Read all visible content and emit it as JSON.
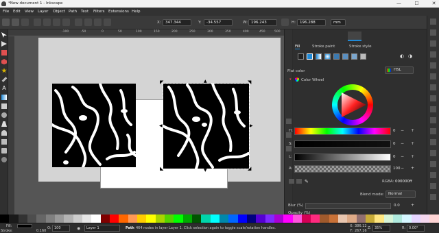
{
  "window": {
    "title": "*New document 1 - Inkscape",
    "minimize": "—",
    "maximize": "☐",
    "close": "✕"
  },
  "menu": [
    "File",
    "Edit",
    "View",
    "Layer",
    "Object",
    "Path",
    "Text",
    "Filters",
    "Extensions",
    "Help"
  ],
  "toolcontrols": {
    "x_label": "X:",
    "x_value": "347.344",
    "y_label": "Y:",
    "y_value": "-34.557",
    "w_label": "W:",
    "w_value": "196.243",
    "h_label": "H:",
    "h_value": "196.288",
    "unit": "mm"
  },
  "ruler_ticks": [
    "-100",
    "-50",
    "0",
    "50",
    "100",
    "150",
    "200",
    "250",
    "300",
    "350",
    "400",
    "450",
    "500"
  ],
  "fill_stroke": {
    "tabs": [
      "Fill",
      "Stroke paint",
      "Stroke style"
    ],
    "flat_color_label": "Flat color",
    "mode": "HSL",
    "color_wheel_label": "Color Wheel",
    "channels": [
      {
        "label": "H:",
        "value": "0"
      },
      {
        "label": "S:",
        "value": "0"
      },
      {
        "label": "L:",
        "value": "0"
      },
      {
        "label": "A:",
        "value": "100"
      }
    ],
    "rgba_label": "RGBA:",
    "rgba_value": "000000ff",
    "blend_label": "Blend mode:",
    "blend_value": "Normal",
    "blur_label": "Blur (%)",
    "blur_value": "0.0",
    "opacity_label": "Opacity (%)"
  },
  "status": {
    "fill_label": "Fill:",
    "stroke_label": "Stroke:",
    "stroke_width": "0.160",
    "opacity_label": "O:",
    "opacity_value": "100",
    "layer": "Layer 1",
    "message_bold": "Path",
    "message": "464 nodes in layer Layer 1. Click selection again to toggle scale/rotation handles.",
    "x_label": "X:",
    "x_value": "386.12",
    "y_label": "Y:",
    "y_value": "267.16",
    "z_label": "Z:",
    "zoom": "35%",
    "r_label": "R:",
    "rotation": "0.00°"
  },
  "palette_colors": [
    "#000000",
    "#1a1a1a",
    "#333333",
    "#4d4d4d",
    "#666666",
    "#808080",
    "#999999",
    "#b3b3b3",
    "#cccccc",
    "#e6e6e6",
    "#ffffff",
    "#800000",
    "#ff0000",
    "#ff6600",
    "#ff9955",
    "#ffcc00",
    "#ffff00",
    "#aad400",
    "#55d400",
    "#00ff00",
    "#00aa00",
    "#005500",
    "#00d4aa",
    "#00ffff",
    "#0088aa",
    "#0066ff",
    "#0000ff",
    "#000080",
    "#5500d4",
    "#7f2aff",
    "#aa00d4",
    "#ff00ff",
    "#ff55dd",
    "#d40055",
    "#ff2a7f",
    "#a05a2c",
    "#c87137",
    "#e9c6af",
    "#deaa87",
    "#916f6f",
    "#c8ab37",
    "#ffe680",
    "#d7f4d7",
    "#afe9dd",
    "#d5f6ff",
    "#e5d5ff",
    "#f4d7ee",
    "#ffd5d5"
  ],
  "accent": "#1f8ad8"
}
